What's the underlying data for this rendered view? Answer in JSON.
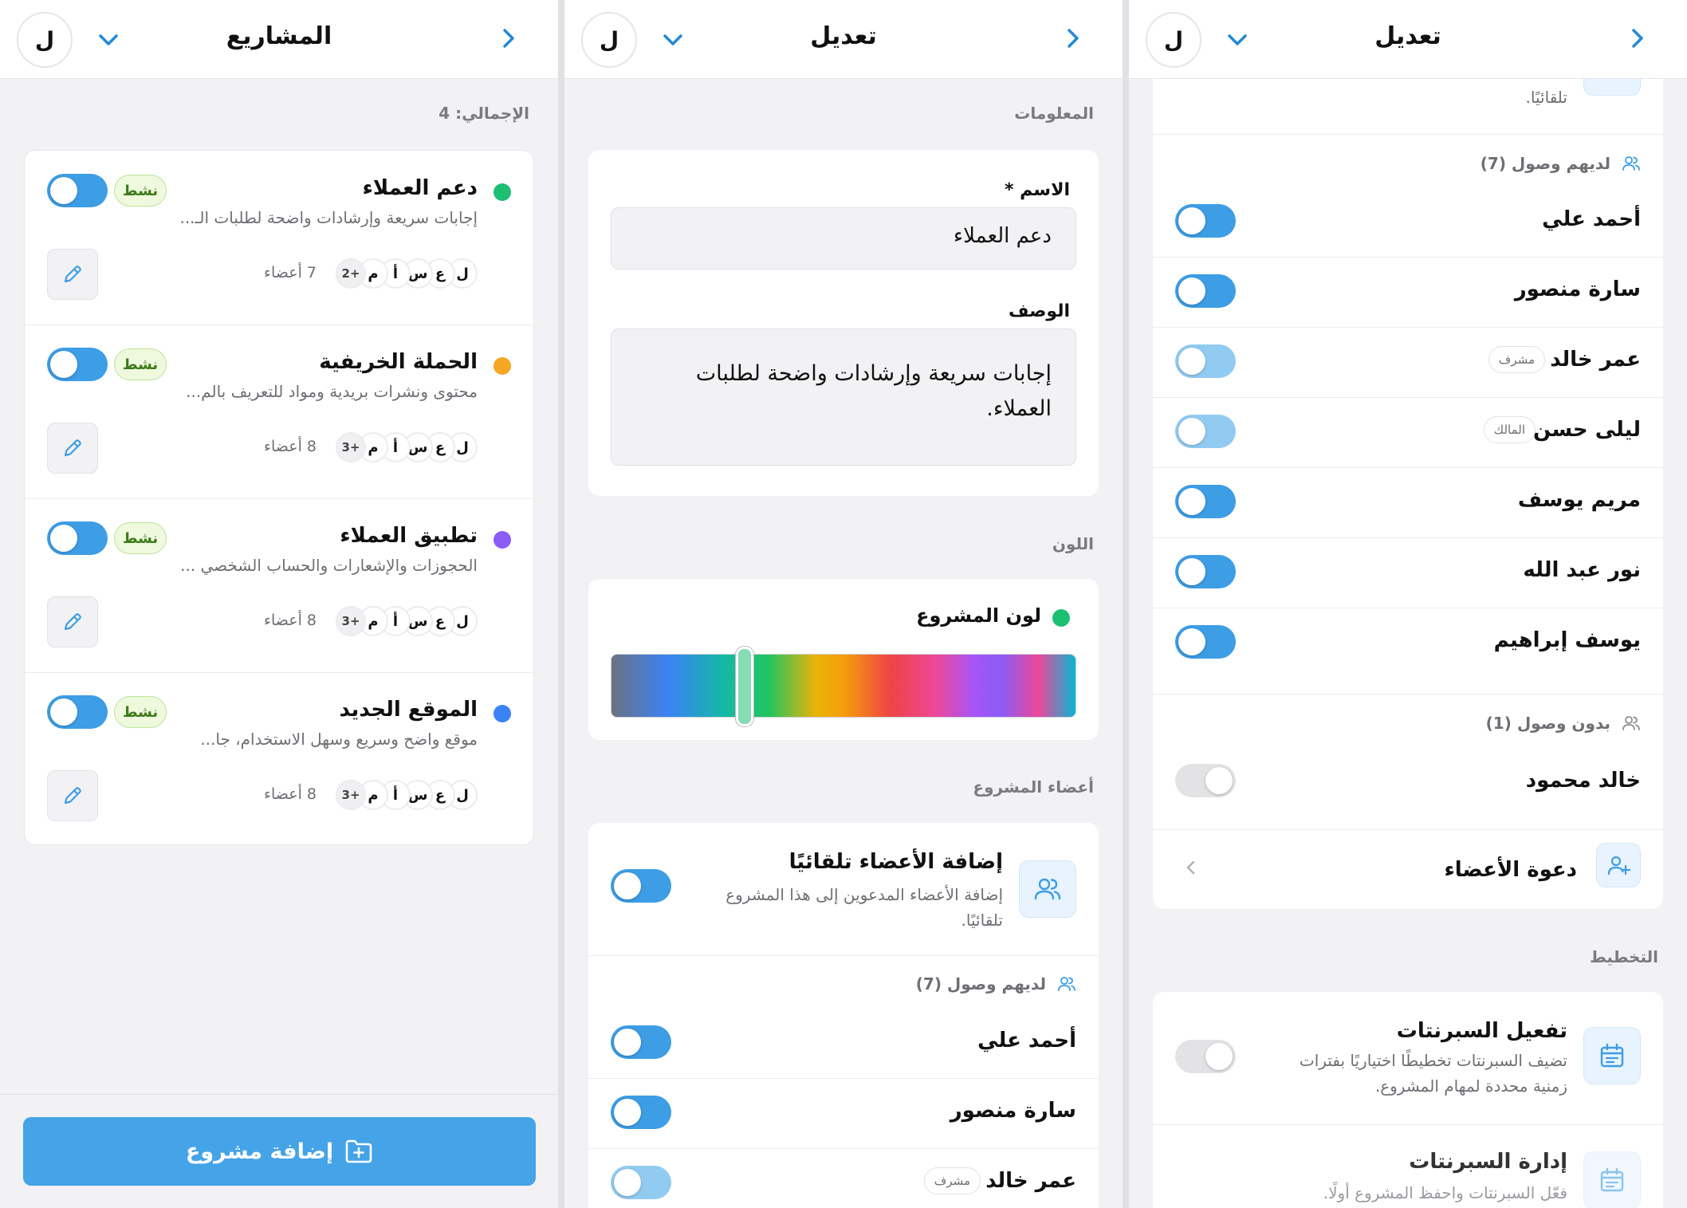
{
  "colors": {
    "accent": "#3d9de5",
    "green": "#1dbf73",
    "orange": "#f5a623",
    "purple": "#8b5cf6",
    "blue": "#3b82f6"
  },
  "avatar_letter": "ل",
  "panel1": {
    "title": "المشاريع",
    "total_label": "الإجمالي: 4",
    "add_button": "إضافة مشروع",
    "projects": [
      {
        "name": "دعم العملاء",
        "desc": "إجابات سريعة وإرشادات واضحة لطلبات الـ...",
        "status": "نشط",
        "members": "7 أعضاء",
        "more": "+2",
        "color": "#1dbf73"
      },
      {
        "name": "الحملة الخريفية",
        "desc": "محتوى ونشرات بريدية ومواد للتعريف بالم...",
        "status": "نشط",
        "members": "8 أعضاء",
        "more": "+3",
        "color": "#f5a623"
      },
      {
        "name": "تطبيق العملاء",
        "desc": "الحجوزات والإشعارات والحساب الشخصي ...",
        "status": "نشط",
        "members": "8 أعضاء",
        "more": "+3",
        "color": "#8b5cf6"
      },
      {
        "name": "الموقع الجديد",
        "desc": "موقع واضح وسريع وسهل الاستخدام، جا...",
        "status": "نشط",
        "members": "8 أعضاء",
        "more": "+3",
        "color": "#3b82f6"
      }
    ],
    "member_letters": [
      "ل",
      "ع",
      "س",
      "أ",
      "م"
    ]
  },
  "panel2": {
    "title": "تعديل",
    "info_label": "المعلومات",
    "name_label": "الاسم *",
    "name_value": "دعم العملاء",
    "desc_label": "الوصف",
    "desc_value": "إجابات سريعة وإرشادات واضحة لطلبات العملاء.",
    "color_label": "اللون",
    "project_color_label": "لون المشروع",
    "members_label": "أعضاء المشروع",
    "auto_add_title": "إضافة الأعضاء تلقائيًا",
    "auto_add_desc": "إضافة الأعضاء المدعوين إلى هذا المشروع تلقائيًا.",
    "access_label": "لديهم وصول (7)",
    "members": [
      {
        "name": "أحمد علي"
      },
      {
        "name": "سارة منصور"
      },
      {
        "name": "عمر خالد",
        "role": "مشرف"
      }
    ]
  },
  "panel3": {
    "title": "تعديل",
    "top_cut_text": "تلقائيًا.",
    "access_label": "لديهم وصول (7)",
    "members": [
      {
        "name": "أحمد علي",
        "state": "on"
      },
      {
        "name": "سارة منصور",
        "state": "on"
      },
      {
        "name": "عمر خالد",
        "role": "مشرف",
        "state": "light"
      },
      {
        "name": "ليلى حسن",
        "role": "المالك",
        "state": "light"
      },
      {
        "name": "مريم يوسف",
        "state": "on"
      },
      {
        "name": "نور عبد الله",
        "state": "on"
      },
      {
        "name": "يوسف إبراهيم",
        "state": "on"
      }
    ],
    "no_access_label": "بدون وصول (1)",
    "no_access_members": [
      {
        "name": "خالد محمود",
        "state": "off"
      }
    ],
    "invite_label": "دعوة الأعضاء",
    "planning_label": "التخطيط",
    "sprints_enable_title": "تفعيل السبرنتات",
    "sprints_enable_desc_1": "تضيف السبرنتات تخطيطًا اختياريًا بفترات",
    "sprints_enable_desc_2": "زمنية محددة لمهام المشروع.",
    "sprints_manage_title": "إدارة السبرنتات",
    "sprints_manage_desc": "فعّل السبرنتات واحفظ المشروع أولًا."
  }
}
